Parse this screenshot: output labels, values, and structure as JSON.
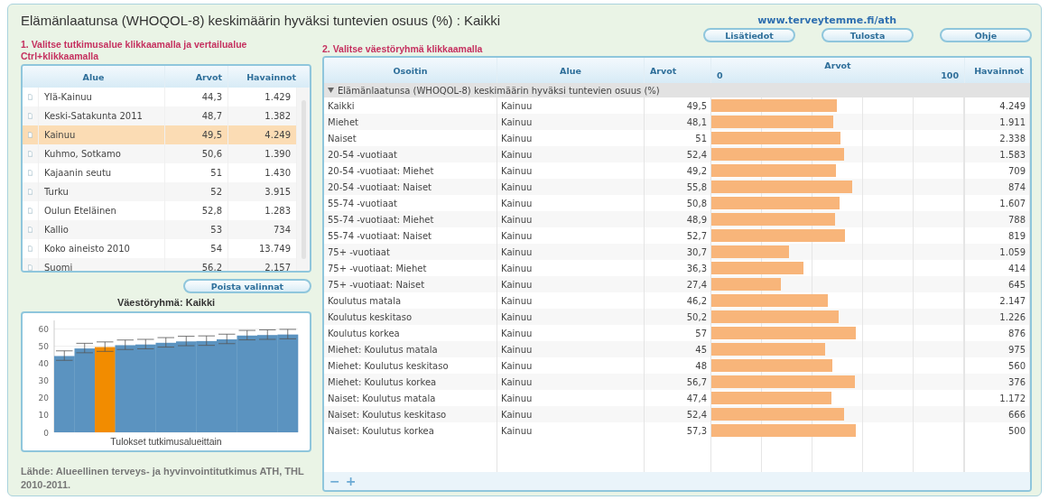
{
  "title": "Elämänlaatunsa (WHOQOL-8) keskimäärin hyväksi tuntevien osuus (%) : Kaikki",
  "link": "www.terveytemme.fi/ath",
  "left": {
    "instruction": "1. Valitse tutkimusalue klikkaamalla ja vertailualue Ctrl+klikkaamalla",
    "table": {
      "columns": [
        "Alue",
        "Arvot",
        "Havainnot"
      ],
      "rows": [
        {
          "alue": "Ylä-Kainuu",
          "arvot": "44,3",
          "havainnot": "1.429",
          "selected": false
        },
        {
          "alue": "Keski-Satakunta 2011",
          "arvot": "48,7",
          "havainnot": "1.382",
          "selected": false
        },
        {
          "alue": "Kainuu",
          "arvot": "49,5",
          "havainnot": "4.249",
          "selected": true
        },
        {
          "alue": "Kuhmo, Sotkamo",
          "arvot": "50,6",
          "havainnot": "1.390",
          "selected": false
        },
        {
          "alue": "Kajaanin seutu",
          "arvot": "51",
          "havainnot": "1.430",
          "selected": false
        },
        {
          "alue": "Turku",
          "arvot": "52",
          "havainnot": "3.915",
          "selected": false
        },
        {
          "alue": "Oulun Eteläinen",
          "arvot": "52,8",
          "havainnot": "1.283",
          "selected": false
        },
        {
          "alue": "Kallio",
          "arvot": "53",
          "havainnot": "734",
          "selected": false
        },
        {
          "alue": "Koko aineisto 2010",
          "arvot": "54",
          "havainnot": "13.749",
          "selected": false
        },
        {
          "alue": "Suomi",
          "arvot": "56,2",
          "havainnot": "2.157",
          "selected": false
        }
      ]
    },
    "clear_button": "Poista valinnat",
    "chart": {
      "title": "Väestöryhmä: Kaikki",
      "chart_data": {
        "type": "bar",
        "xlabel": "Tulokset tutkimusalueittain",
        "ylim": [
          0,
          65
        ],
        "yticks": [
          0,
          10,
          20,
          30,
          40,
          50,
          60
        ],
        "grid": true,
        "series": [
          {
            "color": "#5b93c0",
            "values": [
              44.3,
              48.7,
              null,
              50.6,
              51,
              52,
              52.8,
              53,
              54,
              56.2,
              56.5,
              56.8
            ]
          },
          {
            "color": "#f28c00",
            "values": [
              null,
              null,
              49.5,
              null,
              null,
              null,
              null,
              null,
              null,
              null,
              null,
              null
            ]
          }
        ]
      }
    },
    "source": "Lähde: Alueellinen terveys- ja hyvinvointitutkimus ATH, THL 2010-2011."
  },
  "right": {
    "instruction": "2. Valitse väestöryhmä klikkaamalla",
    "buttons": [
      "Lisätiedot",
      "Tulosta",
      "Ohje"
    ],
    "table": {
      "columns": [
        "Osoitin",
        "Alue",
        "Arvot",
        "Arvot",
        "Havainnot"
      ],
      "axis_min": "0",
      "axis_max": "100",
      "group": {
        "label": "Elämänlaatunsa (WHOQOL-8) keskimäärin hyväksi tuntevien osuus (%)",
        "expanded": true
      },
      "rows": [
        {
          "osoitin": "Kaikki",
          "alue": "Kainuu",
          "arvot": "49,5",
          "level": 0.495,
          "havainnot": "4.249"
        },
        {
          "osoitin": "Miehet",
          "alue": "Kainuu",
          "arvot": "48,1",
          "level": 0.481,
          "havainnot": "1.911"
        },
        {
          "osoitin": "Naiset",
          "alue": "Kainuu",
          "arvot": "51",
          "level": 0.51,
          "havainnot": "2.338"
        },
        {
          "osoitin": "20-54 -vuotiaat",
          "alue": "Kainuu",
          "arvot": "52,4",
          "level": 0.524,
          "havainnot": "1.583"
        },
        {
          "osoitin": "20-54 -vuotiaat: Miehet",
          "alue": "Kainuu",
          "arvot": "49,2",
          "level": 0.492,
          "havainnot": "709"
        },
        {
          "osoitin": "20-54 -vuotiaat: Naiset",
          "alue": "Kainuu",
          "arvot": "55,8",
          "level": 0.558,
          "havainnot": "874"
        },
        {
          "osoitin": "55-74 -vuotiaat",
          "alue": "Kainuu",
          "arvot": "50,8",
          "level": 0.508,
          "havainnot": "1.607"
        },
        {
          "osoitin": "55-74 -vuotiaat: Miehet",
          "alue": "Kainuu",
          "arvot": "48,9",
          "level": 0.489,
          "havainnot": "788"
        },
        {
          "osoitin": "55-74 -vuotiaat: Naiset",
          "alue": "Kainuu",
          "arvot": "52,7",
          "level": 0.527,
          "havainnot": "819"
        },
        {
          "osoitin": "75+ -vuotiaat",
          "alue": "Kainuu",
          "arvot": "30,7",
          "level": 0.307,
          "havainnot": "1.059"
        },
        {
          "osoitin": "75+ -vuotiaat: Miehet",
          "alue": "Kainuu",
          "arvot": "36,3",
          "level": 0.363,
          "havainnot": "414"
        },
        {
          "osoitin": "75+ -vuotiaat: Naiset",
          "alue": "Kainuu",
          "arvot": "27,4",
          "level": 0.274,
          "havainnot": "645"
        },
        {
          "osoitin": "Koulutus matala",
          "alue": "Kainuu",
          "arvot": "46,2",
          "level": 0.462,
          "havainnot": "2.147"
        },
        {
          "osoitin": "Koulutus keskitaso",
          "alue": "Kainuu",
          "arvot": "50,2",
          "level": 0.502,
          "havainnot": "1.226"
        },
        {
          "osoitin": "Koulutus korkea",
          "alue": "Kainuu",
          "arvot": "57",
          "level": 0.57,
          "havainnot": "876"
        },
        {
          "osoitin": "Miehet: Koulutus matala",
          "alue": "Kainuu",
          "arvot": "45",
          "level": 0.45,
          "havainnot": "975"
        },
        {
          "osoitin": "Miehet: Koulutus keskitaso",
          "alue": "Kainuu",
          "arvot": "48",
          "level": 0.48,
          "havainnot": "560"
        },
        {
          "osoitin": "Miehet: Koulutus korkea",
          "alue": "Kainuu",
          "arvot": "56,7",
          "level": 0.567,
          "havainnot": "376"
        },
        {
          "osoitin": "Naiset: Koulutus matala",
          "alue": "Kainuu",
          "arvot": "47,4",
          "level": 0.474,
          "havainnot": "1.172"
        },
        {
          "osoitin": "Naiset: Koulutus keskitaso",
          "alue": "Kainuu",
          "arvot": "52,4",
          "level": 0.524,
          "havainnot": "666"
        },
        {
          "osoitin": "Naiset: Koulutus korkea",
          "alue": "Kainuu",
          "arvot": "57,3",
          "level": 0.573,
          "havainnot": "500"
        }
      ]
    },
    "footer_buttons": [
      "−",
      "+"
    ]
  }
}
